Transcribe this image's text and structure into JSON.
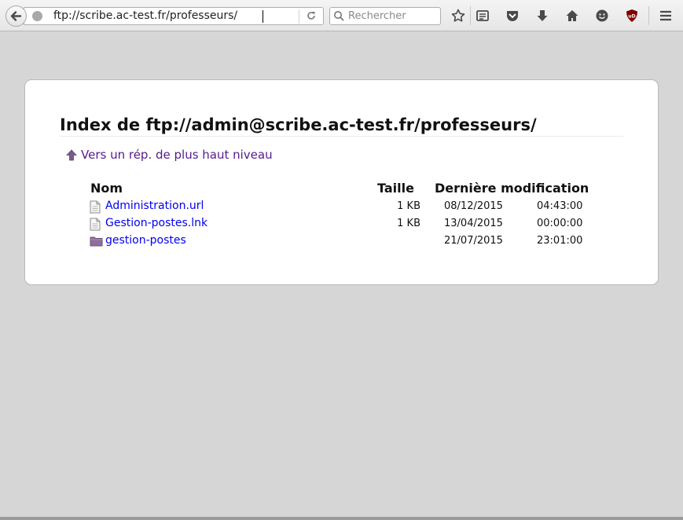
{
  "browser": {
    "url": "ftp://scribe.ac-test.fr/professeurs/",
    "search_placeholder": "Rechercher",
    "icons": [
      "back-arrow-icon",
      "globe-icon",
      "reload-icon",
      "search-icon",
      "bookmark-star-icon",
      "reading-list-icon",
      "pocket-icon",
      "download-icon",
      "home-icon",
      "smiley-icon",
      "ublock-icon",
      "hamburger-menu-icon"
    ],
    "ublock_badge": "uD"
  },
  "page": {
    "title": "Index de ftp://admin@scribe.ac-test.fr/professeurs/",
    "up_link": "Vers un rép. de plus haut niveau",
    "columns": {
      "name": "Nom",
      "size": "Taille",
      "modified": "Dernière modification"
    },
    "files": [
      {
        "name": "Administration.url",
        "size": "1 KB",
        "date": "08/12/2015",
        "time": "04:43:00",
        "type": "file"
      },
      {
        "name": "Gestion-postes.lnk",
        "size": "1 KB",
        "date": "13/04/2015",
        "time": "00:00:00",
        "type": "file"
      },
      {
        "name": "gestion-postes",
        "size": "",
        "date": "21/07/2015",
        "time": "23:01:00",
        "type": "folder"
      }
    ]
  },
  "colors": {
    "link": "#0000ee",
    "visited": "#551a8b",
    "background": "#d6d6d6"
  }
}
